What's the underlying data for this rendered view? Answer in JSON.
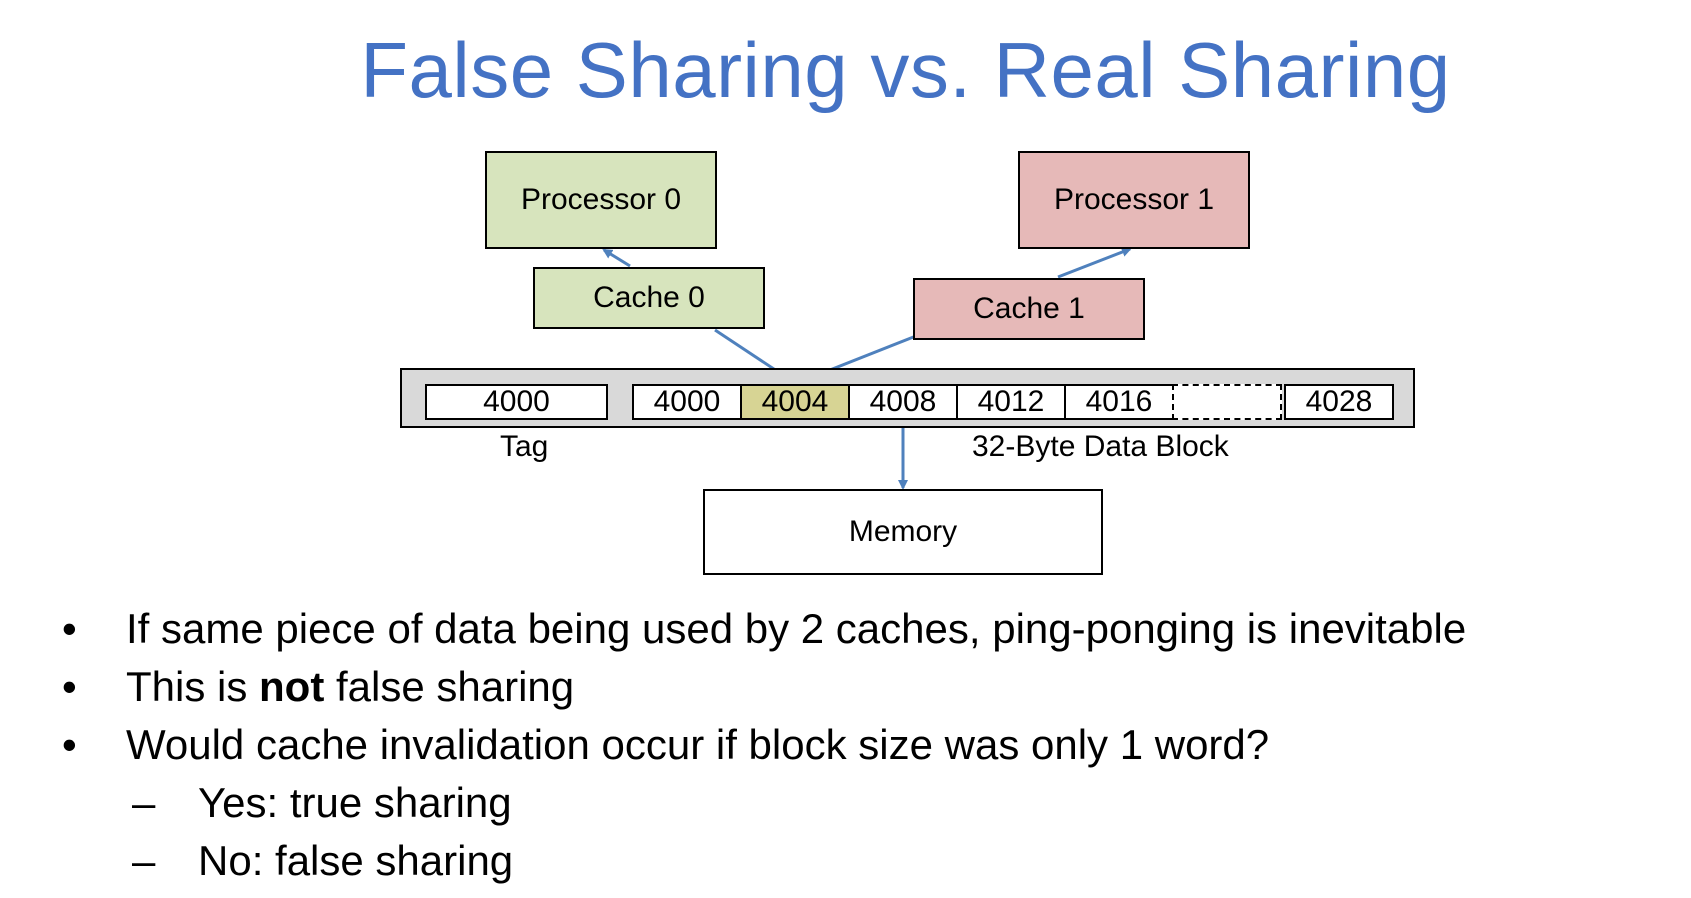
{
  "title": "False Sharing vs. Real Sharing",
  "diagram": {
    "processor0": "Processor 0",
    "processor1": "Processor 1",
    "cache0": "Cache 0",
    "cache1": "Cache 1",
    "tag_value": "4000",
    "data_words": [
      "4000",
      "4004",
      "4008",
      "4012",
      "4016",
      "",
      "4028"
    ],
    "tag_label": "Tag",
    "block_label": "32-Byte Data Block",
    "memory": "Memory",
    "colors": {
      "processor0_fill": "#d7e4bd",
      "processor1_fill": "#e6b9b8",
      "highlight_word": "#d7d494",
      "arrow": "#4f81bd"
    }
  },
  "bullets": [
    {
      "text": "If same piece of data being used by 2 caches, ping-ponging is inevitable"
    },
    {
      "pre": "This is ",
      "bold": "not",
      "post": " false sharing"
    },
    {
      "text": "Would cache invalidation occur if block size was only 1 word?"
    }
  ],
  "sub_bullets": [
    "Yes: true sharing",
    "No: false sharing"
  ],
  "bullet_glyph": "•",
  "dash_glyph": "–"
}
